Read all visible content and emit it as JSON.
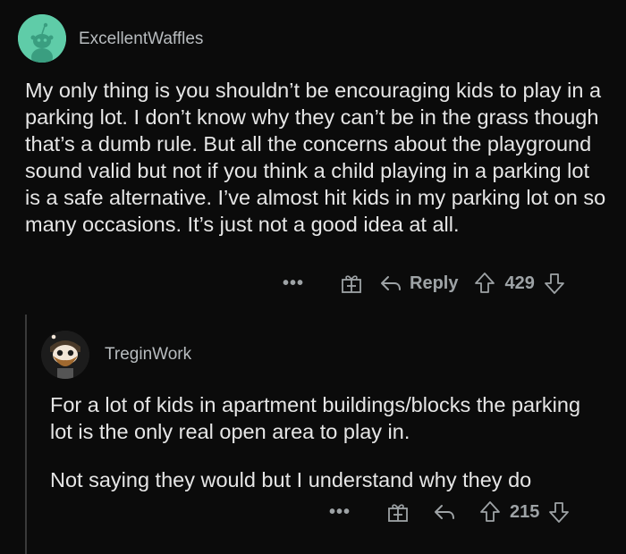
{
  "comments": [
    {
      "username": "ExcellentWaffles",
      "body": "My only thing is you shouldn’t be encouraging kids to play in a parking lot. I don’t know why they can’t be in the grass though that’s a dumb rule. But all the concerns about the playground sound valid but not if you think a child playing in a parking lot is a safe alternative. I’ve almost hit kids in my parking lot on so many occasions. It’s just not a good idea at all.",
      "more": "•••",
      "reply_label": "Reply",
      "votes": "429"
    },
    {
      "username": "TreginWork",
      "paragraphs": [
        "For a lot of kids in apartment buildings/blocks the parking lot is the only real open area to play in.",
        "Not saying they would but I understand why they do"
      ],
      "more": "•••",
      "votes": "215"
    }
  ],
  "icons": {
    "avatar1": "reddit-snoo-avatar",
    "avatar2": "bearded-snoo-avatar",
    "award": "gift-award-icon",
    "reply": "reply-arrow-icon",
    "upvote": "upvote-arrow-icon",
    "downvote": "downvote-arrow-icon"
  },
  "colors": {
    "background": "#0b0b0b",
    "avatar1": "#5fcca8",
    "meta": "#9ea3a6"
  }
}
